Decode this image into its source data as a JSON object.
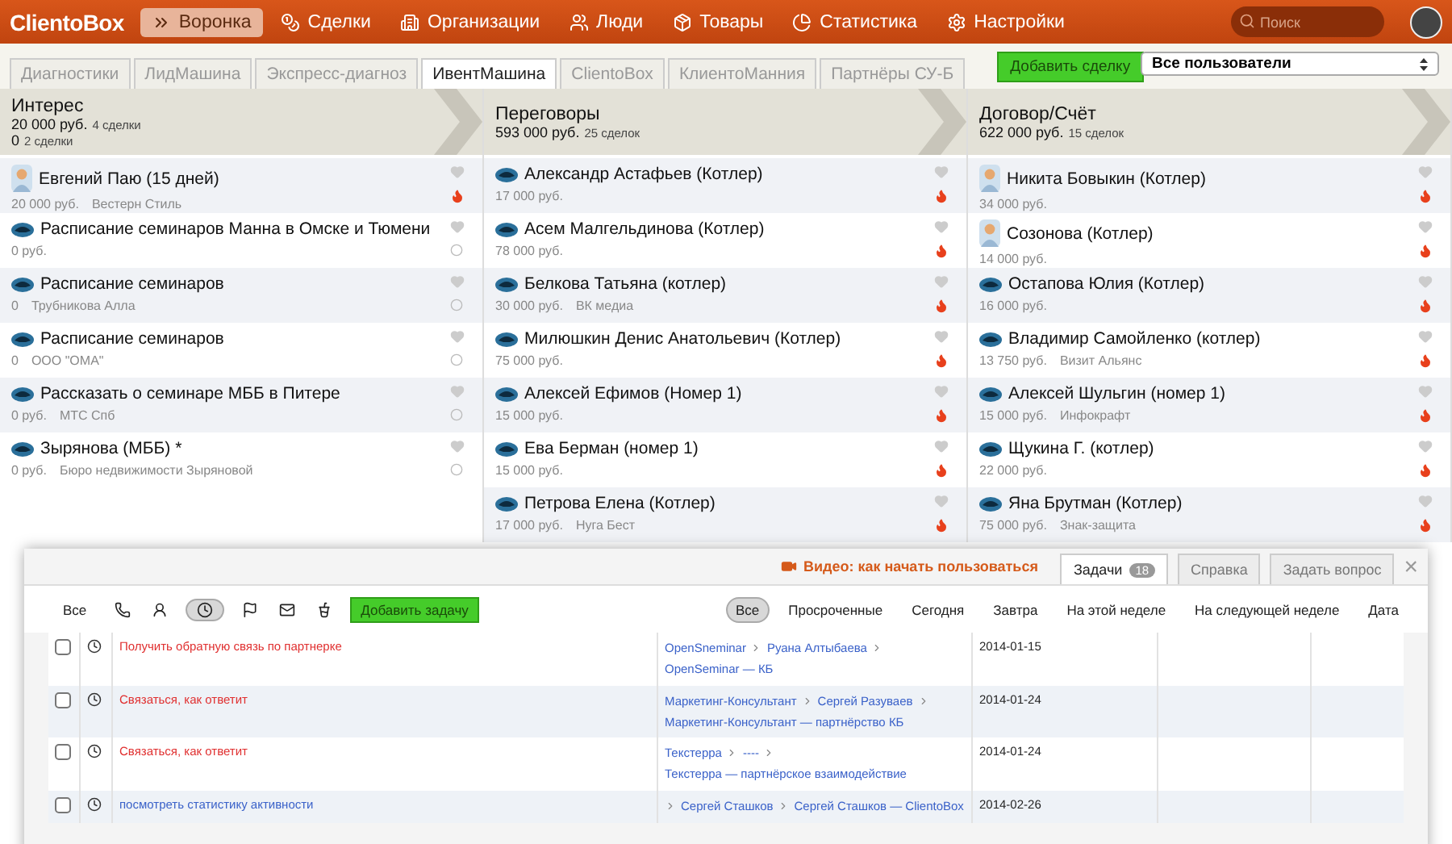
{
  "nav": {
    "logo": "ClientoBox",
    "items": [
      {
        "label": "Воронка",
        "kind": "funnel",
        "selected": true
      },
      {
        "label": "Сделки",
        "kind": "deals",
        "selected": false
      },
      {
        "label": "Организации",
        "kind": "orgs",
        "selected": false
      },
      {
        "label": "Люди",
        "kind": "people",
        "selected": false
      },
      {
        "label": "Товары",
        "kind": "goods",
        "selected": false
      },
      {
        "label": "Статистика",
        "kind": "stats",
        "selected": false
      },
      {
        "label": "Настройки",
        "kind": "settings",
        "selected": false
      }
    ],
    "search": {
      "placeholder": "Поиск"
    }
  },
  "tabs": [
    {
      "label": "Диагностики",
      "selected": false
    },
    {
      "label": "ЛидМашина",
      "selected": false
    },
    {
      "label": "Экспресс-диагноз",
      "selected": false
    },
    {
      "label": "ИвентМашина",
      "selected": true
    },
    {
      "label": "ClientoBox",
      "selected": false
    },
    {
      "label": "КлиентоМанния",
      "selected": false
    },
    {
      "label": "Партнёры СУ-Б",
      "selected": false
    }
  ],
  "add_deal_button": "Добавить сделку",
  "user_select": "Все пользователи",
  "stages": [
    {
      "title": "Интерес",
      "totals": [
        {
          "amount": "20 000 руб.",
          "count": "4 сделки"
        },
        {
          "amount": "0",
          "count": "2 сделки"
        }
      ],
      "deals": [
        {
          "title": "Евгений Паю (15 дней)",
          "amount": "20 000 руб.",
          "company": "Вестерн Стиль",
          "kind": "person",
          "hot": true
        },
        {
          "title": "Расписание семинаров Манна в Омске и Тюмени",
          "amount": "0 руб.",
          "kind": "logo",
          "hot": false
        },
        {
          "title": "Расписание семинаров",
          "amount": "0",
          "company": "Трубникова Алла",
          "kind": "logo",
          "hot": false
        },
        {
          "title": "Расписание семинаров",
          "amount": "0",
          "company": "ООО \"ОМА\"",
          "kind": "logo",
          "hot": false
        },
        {
          "title": "Рассказать о семинаре МББ в Питере",
          "amount": "0 руб.",
          "company": "МТС Спб",
          "kind": "logo",
          "hot": false
        },
        {
          "title": "Зырянова (МББ) *",
          "amount": "0 руб.",
          "company": "Бюро недвижимости Зыряновой",
          "kind": "logo",
          "hot": false
        }
      ]
    },
    {
      "title": "Переговоры",
      "totals": [
        {
          "amount": "593 000 руб.",
          "count": "25 сделок"
        }
      ],
      "deals": [
        {
          "title": "Александр Астафьев (Котлер)",
          "amount": "17 000 руб.",
          "kind": "logo",
          "hot": true
        },
        {
          "title": "Асем Малгельдинова (Котлер)",
          "amount": "78 000 руб.",
          "kind": "logo",
          "hot": true
        },
        {
          "title": "Белкова Татьяна (котлер)",
          "amount": "30 000 руб.",
          "company": "ВК медиа",
          "kind": "logo",
          "hot": true
        },
        {
          "title": "Милюшкин Денис Анатольевич (Котлер)",
          "amount": "75 000 руб.",
          "kind": "logo",
          "hot": true
        },
        {
          "title": "Алексей Ефимов (Номер 1)",
          "amount": "15 000 руб.",
          "kind": "logo",
          "hot": true
        },
        {
          "title": "Ева Берман (номер 1)",
          "amount": "15 000 руб.",
          "kind": "logo",
          "hot": true
        },
        {
          "title": "Петрова Елена (Котлер)",
          "amount": "17 000 руб.",
          "company": "Нуга Бест",
          "kind": "logo",
          "hot": true
        }
      ]
    },
    {
      "title": "Договор/Счёт",
      "totals": [
        {
          "amount": "622 000 руб.",
          "count": "15 сделок"
        }
      ],
      "deals": [
        {
          "title": "Никита Бовыкин (Котлер)",
          "amount": "34 000 руб.",
          "kind": "person",
          "hot": true
        },
        {
          "title": "Созонова (Котлер)",
          "amount": "14 000 руб.",
          "kind": "person",
          "hot": true
        },
        {
          "title": "Остапова Юлия (Котлер)",
          "amount": "16 000 руб.",
          "kind": "logo",
          "hot": true
        },
        {
          "title": "Владимир Самойленко (котлер)",
          "amount": "13 750 руб.",
          "company": "Визит Альянс",
          "kind": "logo",
          "hot": true
        },
        {
          "title": "Алексей Шульгин (номер 1)",
          "amount": "15 000 руб.",
          "company": "Инфокрафт",
          "kind": "logo",
          "hot": true
        },
        {
          "title": "Щукина Г. (котлер)",
          "amount": "22 000 руб.",
          "kind": "logo",
          "hot": true
        },
        {
          "title": "Яна Брутман (Котлер)",
          "amount": "75 000 руб.",
          "company": "Знак-защита",
          "kind": "logo",
          "hot": true
        }
      ]
    }
  ],
  "tasks_panel": {
    "video_link": "Видео: как начать пользоваться",
    "tabs": [
      {
        "label": "Задачи",
        "badge": "18",
        "selected": true
      },
      {
        "label": "Справка",
        "selected": false
      },
      {
        "label": "Задать вопрос",
        "selected": false
      }
    ],
    "close": "×",
    "type_filter": {
      "all": "Все",
      "icons": [
        {
          "kind": "phone",
          "selected": false
        },
        {
          "kind": "meeting",
          "selected": false
        },
        {
          "kind": "clock",
          "selected": true
        },
        {
          "kind": "flag",
          "selected": false
        },
        {
          "kind": "mail",
          "selected": false
        },
        {
          "kind": "cup",
          "selected": false
        }
      ]
    },
    "add_task_button": "Добавить задачу",
    "date_filters": [
      {
        "label": "Все",
        "selected": true
      },
      {
        "label": "Просроченные",
        "selected": false
      },
      {
        "label": "Сегодня",
        "selected": false
      },
      {
        "label": "Завтра",
        "selected": false
      },
      {
        "label": "На этой неделе",
        "selected": false
      },
      {
        "label": "На следующей неделе",
        "selected": false
      },
      {
        "label": "Дата",
        "selected": false
      }
    ],
    "tasks": [
      {
        "checked": false,
        "title": "Получить обратную связь по партнерке",
        "overdue": true,
        "leading_separator": false,
        "path": [
          "OpenSneminar",
          "Руана Алтыбаева",
          "OpenSeminar — КБ"
        ],
        "date": "2014-01-15"
      },
      {
        "checked": false,
        "title": "Связаться, как ответит",
        "overdue": true,
        "leading_separator": false,
        "path": [
          "Маркетинг-Консультант",
          "Сергей Разуваев",
          "Маркетинг-Консультант — партнёрство КБ"
        ],
        "date": "2014-01-24"
      },
      {
        "checked": false,
        "title": "Связаться, как ответит",
        "overdue": true,
        "leading_separator": false,
        "path": [
          "Текстерра",
          "----",
          "Текстерра — партнёрское взаимодействие"
        ],
        "date": "2014-01-24"
      },
      {
        "checked": false,
        "title": "посмотреть статистику активности",
        "overdue": false,
        "leading_separator": true,
        "path": [
          "Сергей Сташков",
          "Сергей Сташков — ClientoBox"
        ],
        "date": "2014-02-26"
      }
    ]
  }
}
